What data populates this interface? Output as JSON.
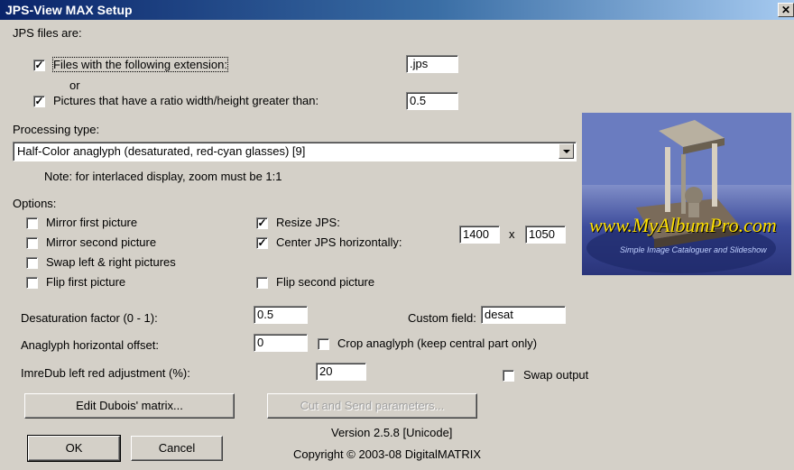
{
  "window": {
    "title": "JPS-View MAX Setup",
    "close_glyph": "✕"
  },
  "jps_files": {
    "heading": "JPS files are:",
    "ext_checked": true,
    "ext_label": "Files with the following extension:",
    "ext_value": ".jps",
    "or_label": "or",
    "ratio_checked": true,
    "ratio_label": "Pictures that have a ratio width/height greater than:",
    "ratio_value": "0.5"
  },
  "processing": {
    "label": "Processing type:",
    "selected": "Half-Color anaglyph (desaturated, red-cyan glasses)  [9]",
    "note": "Note: for interlaced display, zoom must be 1:1"
  },
  "options": {
    "heading": "Options:",
    "mirror_first": {
      "label": "Mirror first picture",
      "checked": false
    },
    "mirror_second": {
      "label": "Mirror second picture",
      "checked": false
    },
    "swap_lr": {
      "label": "Swap left & right pictures",
      "checked": false
    },
    "flip_first": {
      "label": "Flip first picture",
      "checked": false
    },
    "resize_jps": {
      "label": "Resize JPS:",
      "checked": true
    },
    "center_jps": {
      "label": "Center JPS horizontally:",
      "checked": true
    },
    "flip_second": {
      "label": "Flip second picture",
      "checked": false
    },
    "resize_w": "1400",
    "times": "x",
    "resize_h": "1050"
  },
  "desaturation": {
    "label": "Desaturation factor (0 - 1):",
    "value": "0.5"
  },
  "custom_field": {
    "label": "Custom field:",
    "value": "desat"
  },
  "anaglyph_offset": {
    "label": "Anaglyph horizontal offset:",
    "value": "0"
  },
  "crop": {
    "label": "Crop anaglyph (keep central part only)",
    "checked": false
  },
  "imredub": {
    "label": "ImreDub left red adjustment (%):",
    "value": "20"
  },
  "swap_output": {
    "label": "Swap output",
    "checked": false
  },
  "buttons": {
    "edit_dubois": "Edit Dubois' matrix...",
    "cut_send": "Cut and Send parameters...",
    "ok": "OK",
    "cancel": "Cancel"
  },
  "footer": {
    "version": "Version 2.5.8 [Unicode]",
    "copyright": "Copyright © 2003-08 DigitalMATRIX"
  },
  "banner": {
    "brand": "www.MyAlbumPro.com",
    "tagline": "Simple Image Cataloguer and Slideshow"
  },
  "colors": {
    "titlebar_start": "#0a246a",
    "dialog_bg": "#d4d0c8"
  }
}
